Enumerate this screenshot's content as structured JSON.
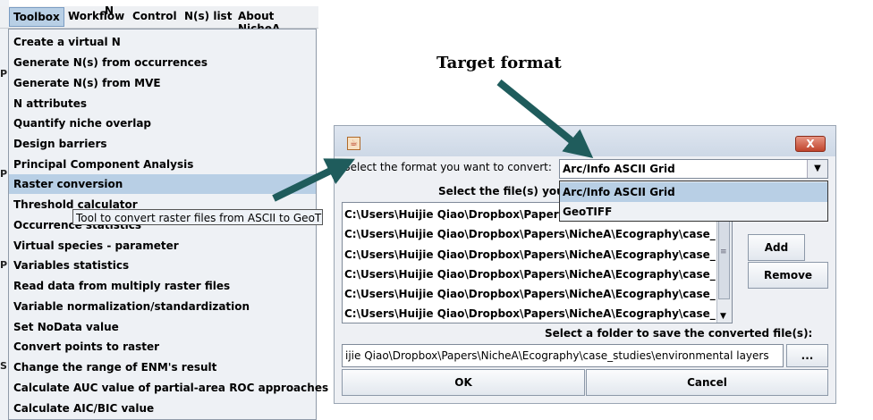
{
  "menubar": {
    "items": [
      "Toolbox",
      "Workflow",
      "Control",
      "N(s) list",
      "About NicheA"
    ],
    "active_index": 0,
    "stray_text": "N"
  },
  "left_strip_letters": [
    "P",
    "P",
    "P",
    "S"
  ],
  "toolbox_menu": {
    "items": [
      "Create a virtual N",
      "Generate N(s) from occurrences",
      "Generate N(s) from MVE",
      "N attributes",
      "Quantify niche overlap",
      "Design barriers",
      "Principal Component Analysis",
      "Raster conversion",
      "Threshold calculator",
      "Occurrence statistics",
      "Virtual species - parameter",
      "Variables statistics",
      "Read data from multiply raster files",
      "Variable normalization/standardization",
      "Set NoData value",
      "Convert points to raster",
      "Change the range of ENM's result",
      "Calculate AUC value of partial-area ROC approaches",
      "Calculate AIC/BIC value"
    ],
    "selected_index": 7
  },
  "tooltip": "Tool to convert raster files from ASCII to GeoTI",
  "annotation": "Target format",
  "dialog": {
    "icon": "java-icon",
    "close_label": "X",
    "format_prompt": "Select the format you want to convert:",
    "format_value": "Arc/Info ASCII Grid",
    "format_options": [
      "Arc/Info ASCII Grid",
      "GeoTIFF"
    ],
    "format_selected_index": 0,
    "files_prompt": "Select the file(s) you w",
    "files": [
      "C:\\Users\\Huijie Qiao\\Dropbox\\Papers\\NicheA\\Ecography\\case_studie",
      "C:\\Users\\Huijie Qiao\\Dropbox\\Papers\\NicheA\\Ecography\\case_studie",
      "C:\\Users\\Huijie Qiao\\Dropbox\\Papers\\NicheA\\Ecography\\case_studie",
      "C:\\Users\\Huijie Qiao\\Dropbox\\Papers\\NicheA\\Ecography\\case_studie",
      "C:\\Users\\Huijie Qiao\\Dropbox\\Papers\\NicheA\\Ecography\\case_studie",
      "C:\\Users\\Huijie Qiao\\Dropbox\\Papers\\NicheA\\Ecography\\case_studie"
    ],
    "add_label": "Add",
    "remove_label": "Remove",
    "folder_prompt": "Select a folder to save the converted file(s):",
    "folder_value": "ijie Qiao\\Dropbox\\Papers\\NicheA\\Ecography\\case_studies\\environmental layers",
    "browse_label": "...",
    "ok_label": "OK",
    "cancel_label": "Cancel"
  },
  "colors": {
    "selection": "#b8cfe5",
    "arrow": "#1f5c5c"
  }
}
